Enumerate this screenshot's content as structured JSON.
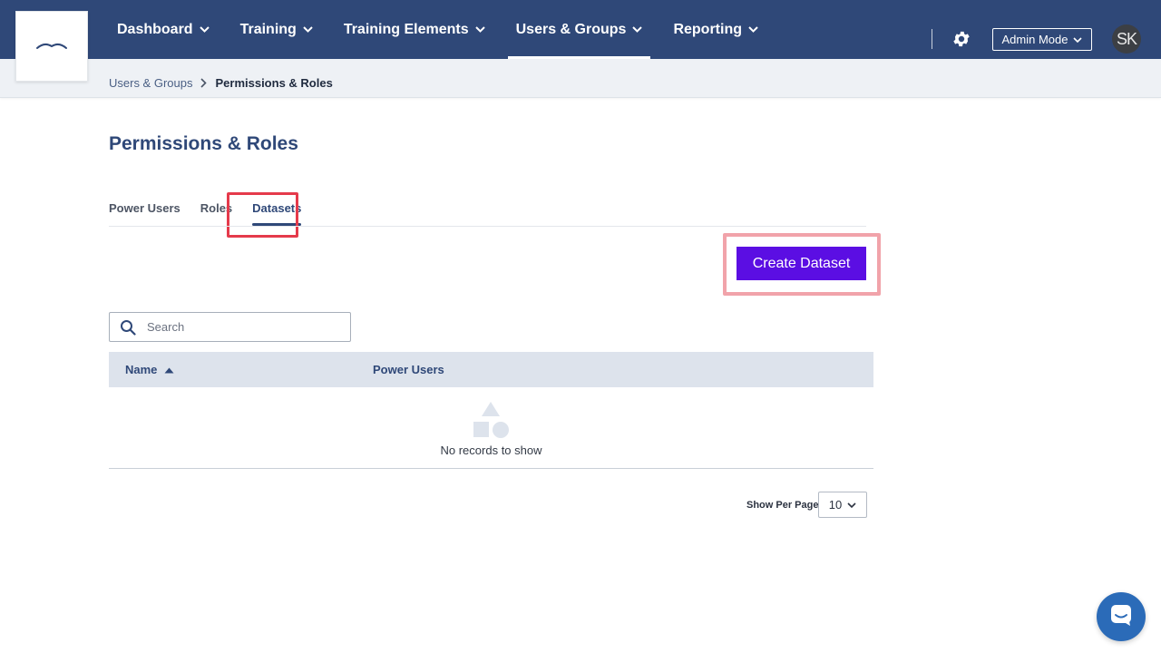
{
  "nav": {
    "items": [
      {
        "label": "Dashboard"
      },
      {
        "label": "Training"
      },
      {
        "label": "Training Elements"
      },
      {
        "label": "Users & Groups"
      },
      {
        "label": "Reporting"
      }
    ],
    "active_index": 3,
    "admin_mode_label": "Admin Mode",
    "avatar_initials": "SK"
  },
  "breadcrumb": {
    "parent": "Users & Groups",
    "current": "Permissions & Roles"
  },
  "page": {
    "title": "Permissions & Roles",
    "tabs": [
      {
        "label": "Power Users"
      },
      {
        "label": "Roles"
      },
      {
        "label": "Datasets"
      }
    ],
    "active_tab": "Datasets",
    "create_button_label": "Create Dataset"
  },
  "search": {
    "placeholder": "Search",
    "value": ""
  },
  "table": {
    "columns": [
      {
        "label": "Name",
        "sort": "ascending"
      },
      {
        "label": "Power Users"
      }
    ],
    "empty_message": "No records to show"
  },
  "pagination": {
    "per_page_label": "Show Per Page",
    "per_page_value": "10"
  },
  "colors": {
    "nav_bg": "#2f4878",
    "accent_button": "#5b0ee3",
    "highlight_red": "#e53a4b",
    "chat_button": "#2b6bb8"
  },
  "icons": [
    "logo-icon",
    "chevron-down-icon",
    "gear-icon",
    "chevron-right-icon",
    "search-icon",
    "sort-ascending-icon",
    "empty-shapes-icon",
    "chat-icon"
  ]
}
